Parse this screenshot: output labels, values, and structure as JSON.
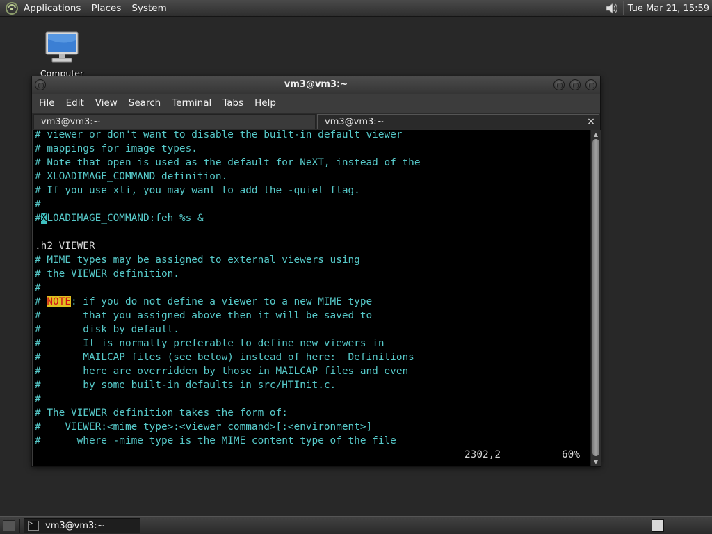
{
  "top_panel": {
    "menus": [
      "Applications",
      "Places",
      "System"
    ],
    "clock": "Tue Mar 21, 15:59",
    "icons": {
      "logo": "distro-logo-icon",
      "volume": "volume-icon"
    }
  },
  "desktop": {
    "icons": [
      {
        "label": "Computer",
        "icon": "computer-icon"
      }
    ]
  },
  "window": {
    "title": "vm3@vm3:~",
    "menu": [
      "File",
      "Edit",
      "View",
      "Search",
      "Terminal",
      "Tabs",
      "Help"
    ],
    "tabs": [
      {
        "label": "vm3@vm3:~",
        "active": false
      },
      {
        "label": "vm3@vm3:~",
        "active": true
      }
    ],
    "tab_close_glyph": "×"
  },
  "terminal": {
    "lines": [
      "# viewer or don't want to disable the built-in default viewer",
      "# mappings for image types.",
      "# Note that open is used as the default for NeXT, instead of the",
      "# XLOADIMAGE_COMMAND definition.",
      "# If you use xli, you may want to add the -quiet flag.",
      "#",
      {
        "prefix": "#",
        "cursor": "X",
        "rest": "LOADIMAGE_COMMAND:feh %s &"
      },
      "",
      {
        "plain": ".h2 VIEWER"
      },
      "# MIME types may be assigned to external viewers using",
      "# the VIEWER definition.",
      "#",
      {
        "prefix": "# ",
        "highlight": "NOTE",
        "rest": ": if you do not define a viewer to a new MIME type"
      },
      "#       that you assigned above then it will be saved to",
      "#       disk by default.",
      "#       It is normally preferable to define new viewers in",
      "#       MAILCAP files (see below) instead of here:  Definitions",
      "#       here are overridden by those in MAILCAP files and even",
      "#       by some built-in defaults in src/HTInit.c.",
      "#",
      "# The VIEWER definition takes the form of:",
      "#    VIEWER:<mime type>:<viewer command>[:<environment>]",
      "#      where -mime type is the MIME content type of the file"
    ],
    "status": {
      "position": "2302,2",
      "percent": "60%"
    },
    "colors": {
      "comment": "#56c9c9",
      "plain": "#d7d7d7",
      "highlight_bg": "#e0c020",
      "highlight_fg": "#d0101a",
      "background": "#000000"
    }
  },
  "bottom_panel": {
    "tasks": [
      {
        "label": "vm3@vm3:~",
        "icon": "terminal-icon"
      }
    ]
  }
}
